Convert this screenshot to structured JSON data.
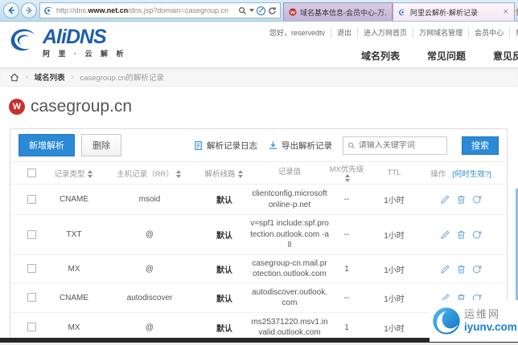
{
  "browser": {
    "url": {
      "prefix": "http://dns.",
      "domain": "www.net.cn",
      "path": "/dns.jsp?domain=casegroup.cn"
    },
    "tabs": [
      {
        "title": "域名基本信息-会员中心-万..."
      },
      {
        "title": "阿里云解析-解析记录"
      }
    ],
    "close_tab_glyph": "×"
  },
  "header": {
    "logo_text": "AliDNS",
    "logo_sub": "阿 里 · 云 解 析",
    "user_links": [
      "您好，reservedtv",
      "退出",
      "进入万网首页",
      "万网域名管理",
      "会员中心",
      "帮助"
    ],
    "nav_links": [
      "域名列表",
      "常见问题",
      "意见反馈"
    ]
  },
  "breadcrumb": {
    "level1": "域名列表",
    "level2": "casegroup.cn的解析记录"
  },
  "domain": {
    "name": "casegroup.cn",
    "badge": "W"
  },
  "toolbar": {
    "add": "新增解析",
    "delete": "删除",
    "log": "解析记录日志",
    "export": "导出解析记录",
    "search_placeholder": "请输入关键字词",
    "search": "搜索"
  },
  "table": {
    "headers": {
      "type": "记录类型",
      "rr": "主机记录（RR）",
      "line": "解析线路",
      "value": "记录值",
      "mx": "MX优先级",
      "ttl": "TTL",
      "ops": "操作",
      "ops_link": "[何时生效?]"
    },
    "rows": [
      {
        "type": "CNAME",
        "rr": "msoid",
        "line": "默认",
        "value": "clientconfig.microsoftonline-p.net",
        "mx": "--",
        "ttl": "1小时"
      },
      {
        "type": "TXT",
        "rr": "@",
        "line": "默认",
        "value": "v=spf1 include:spf.protection.outlook.com -all",
        "mx": "--",
        "ttl": "1小时"
      },
      {
        "type": "MX",
        "rr": "@",
        "line": "默认",
        "value": "casegroup-cn.mail.protection.outlook.com",
        "mx": "1",
        "ttl": "1小时"
      },
      {
        "type": "CNAME",
        "rr": "autodiscover",
        "line": "默认",
        "value": "autodiscover.outlook.com",
        "mx": "--",
        "ttl": "1小时"
      },
      {
        "type": "MX",
        "rr": "@",
        "line": "默认",
        "value": "ms25371220.msv1.invalid.outlook.com",
        "mx": "1",
        "ttl": "1小时"
      }
    ]
  },
  "watermark": {
    "name": "运维网",
    "site": "iyunv.com"
  },
  "colors": {
    "accent_blue": "#2b8ad6",
    "logo_blue": "#1d5fa9",
    "link_blue": "#2a8cd8",
    "badge_red": "#c5312d"
  }
}
